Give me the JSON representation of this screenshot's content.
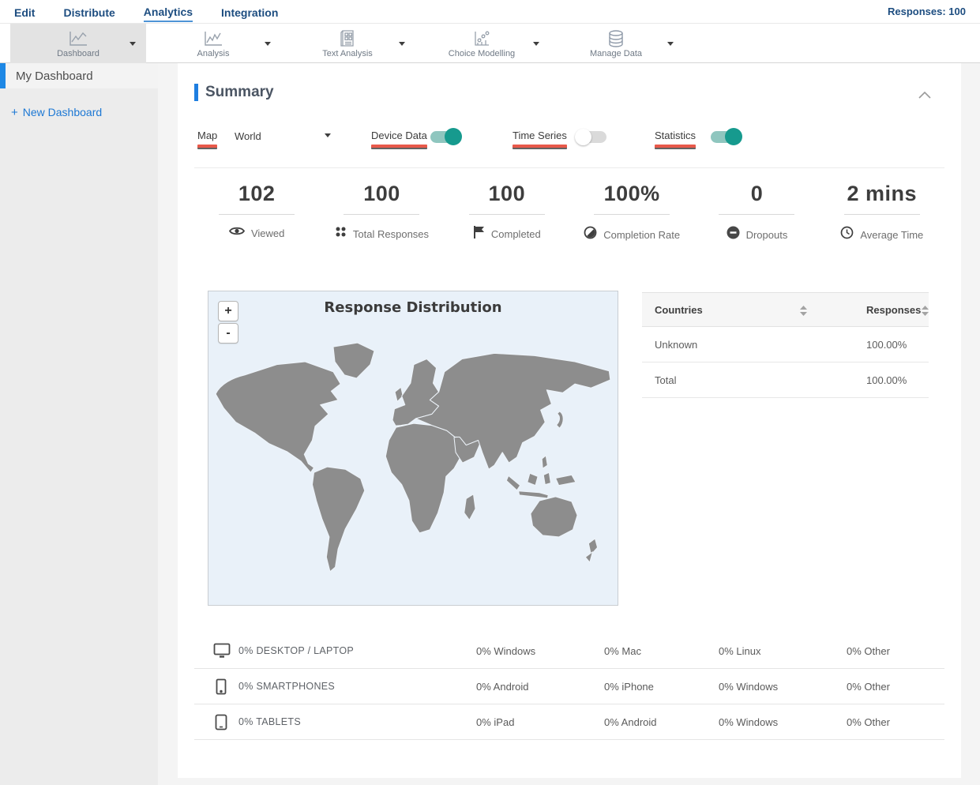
{
  "nav": {
    "items": [
      {
        "label": "Edit",
        "active": false
      },
      {
        "label": "Distribute",
        "active": false
      },
      {
        "label": "Analytics",
        "active": true
      },
      {
        "label": "Integration",
        "active": false
      }
    ],
    "responses_label": "Responses: 100"
  },
  "toolbar": {
    "items": [
      {
        "label": "Dashboard",
        "icon": "line-chart-icon",
        "selected": true
      },
      {
        "label": "Analysis",
        "icon": "line-chart-icon",
        "selected": false
      },
      {
        "label": "Text Analysis",
        "icon": "document-grid-icon",
        "selected": false
      },
      {
        "label": "Choice Modelling",
        "icon": "scatter-chart-icon",
        "selected": false
      },
      {
        "label": "Manage Data",
        "icon": "database-icon",
        "selected": false
      }
    ]
  },
  "sidebar": {
    "items": [
      {
        "label": "My Dashboard",
        "active": true
      }
    ],
    "new_dashboard": {
      "plus": "+",
      "label": "New Dashboard"
    }
  },
  "summary": {
    "title": "Summary"
  },
  "controls": {
    "map_label": "Map",
    "map_value": "World",
    "device_data_label": "Device Data",
    "device_data_on": true,
    "time_series_label": "Time Series",
    "time_series_on": false,
    "statistics_label": "Statistics",
    "statistics_on": true
  },
  "stats": {
    "items": [
      {
        "value": "102",
        "label": "Viewed",
        "icon": "eye-icon"
      },
      {
        "value": "100",
        "label": "Total Responses",
        "icon": "dots-icon"
      },
      {
        "value": "100",
        "label": "Completed",
        "icon": "flag-icon"
      },
      {
        "value": "100%",
        "label": "Completion Rate",
        "icon": "half-circle-icon"
      },
      {
        "value": "0",
        "label": "Dropouts",
        "icon": "minus-circle-icon"
      },
      {
        "value": "2 mins",
        "label": "Average Time",
        "icon": "clock-icon"
      }
    ]
  },
  "map": {
    "title": "Response Distribution",
    "zoom_in_label": "+",
    "zoom_out_label": "-",
    "sea_color": "#e9f1f9",
    "land_color": "#8d8d8d"
  },
  "countries_table": {
    "headers": [
      "Countries",
      "Responses"
    ],
    "rows": [
      {
        "country": "Unknown",
        "responses": "100.00%"
      },
      {
        "country": "Total",
        "responses": "100.00%"
      }
    ]
  },
  "device_table": {
    "rows": [
      {
        "icon": "desktop-icon",
        "device": "0% DESKTOP / LAPTOP",
        "values": [
          "0% Windows",
          "0% Mac",
          "0% Linux",
          "0% Other"
        ]
      },
      {
        "icon": "smartphone-icon",
        "device": "0% SMARTPHONES",
        "values": [
          "0% Android",
          "0% iPhone",
          "0% Windows",
          "0% Other"
        ]
      },
      {
        "icon": "tablet-icon",
        "device": "0% TABLETS",
        "values": [
          "0% iPad",
          "0% Android",
          "0% Windows",
          "0% Other"
        ]
      }
    ]
  },
  "colors": {
    "nav_blue": "#1d4d80",
    "accent_blue": "#1e7ee0",
    "annotation_red": "#e8594a",
    "toggle_on": "#169a8e",
    "land_gray": "#8d8d8d"
  }
}
